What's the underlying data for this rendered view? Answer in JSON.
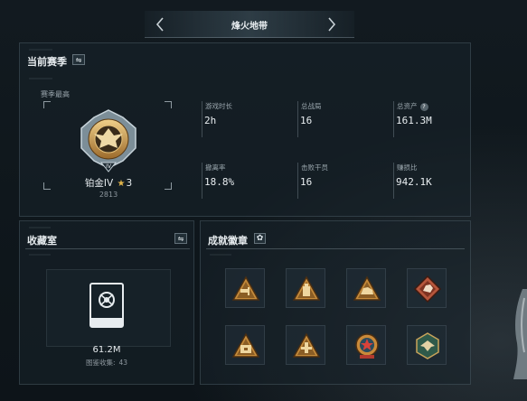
{
  "header": {
    "title": "烽火地带"
  },
  "season": {
    "title": "当前赛季",
    "best_label": "赛季最高",
    "rank_name": "铂金IV",
    "rank_stars": "3",
    "rank_score": "2813",
    "stats": [
      {
        "label": "游戏时长",
        "value": "2h",
        "help": false
      },
      {
        "label": "总战局",
        "value": "16",
        "help": false
      },
      {
        "label": "总资产",
        "value": "161.3M",
        "help": true
      },
      {
        "label": "撤离率",
        "value": "18.8%",
        "help": false
      },
      {
        "label": "击败干员",
        "value": "16",
        "help": false
      },
      {
        "label": "赚损比",
        "value": "942.1K",
        "help": false
      }
    ]
  },
  "collection": {
    "title": "收藏室",
    "value": "61.2M",
    "count_label": "图鉴收集:",
    "count_value": "43"
  },
  "badges": {
    "title": "成就徽章",
    "items": [
      {
        "icon": "weapon-triangle-badge"
      },
      {
        "icon": "ammo-triangle-badge"
      },
      {
        "icon": "beast-triangle-badge"
      },
      {
        "icon": "hound-diamond-badge"
      },
      {
        "icon": "crate-triangle-badge"
      },
      {
        "icon": "tower-triangle-badge"
      },
      {
        "icon": "star-emblem-badge"
      },
      {
        "icon": "eagle-hexagon-badge"
      }
    ]
  },
  "colors": {
    "accent": "#e0b44a",
    "background": "#0d1419",
    "text": "#e7ecef"
  }
}
